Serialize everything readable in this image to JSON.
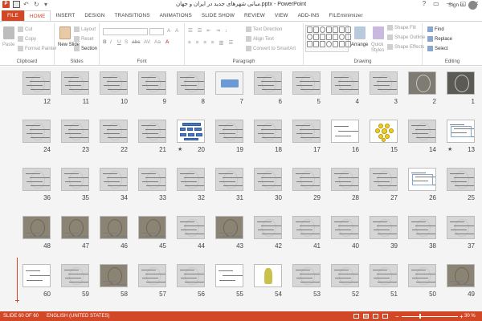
{
  "app": {
    "title": "مبانی شهرهای جدید در ایران و جهان.pptx - PowerPoint",
    "sign_in": "Sign in",
    "window_buttons": [
      "?",
      "▭",
      "—",
      "▢",
      "✕"
    ]
  },
  "tabs": [
    {
      "label": "FILE",
      "kind": "file"
    },
    {
      "label": "HOME",
      "kind": "active"
    },
    {
      "label": "INSERT",
      "kind": ""
    },
    {
      "label": "DESIGN",
      "kind": ""
    },
    {
      "label": "TRANSITIONS",
      "kind": ""
    },
    {
      "label": "ANIMATIONS",
      "kind": ""
    },
    {
      "label": "SLIDE SHOW",
      "kind": ""
    },
    {
      "label": "REVIEW",
      "kind": ""
    },
    {
      "label": "VIEW",
      "kind": ""
    },
    {
      "label": "ADD-INS",
      "kind": ""
    },
    {
      "label": "FILEminimizer",
      "kind": ""
    }
  ],
  "ribbon": {
    "clipboard": {
      "label": "Clipboard",
      "paste": "Paste",
      "cut": "Cut",
      "copy": "Copy",
      "format_painter": "Format Painter"
    },
    "slides": {
      "label": "Slides",
      "new_slide": "New Slide",
      "layout": "Layout",
      "reset": "Reset",
      "section": "Section"
    },
    "font": {
      "label": "Font",
      "format_buttons": [
        "B",
        "I",
        "U",
        "S",
        "abc",
        "AV",
        "Aa",
        "A"
      ]
    },
    "paragraph": {
      "label": "Paragraph",
      "text_direction": "Text Direction",
      "align_text": "Align Text",
      "convert_smartart": "Convert to SmartArt"
    },
    "drawing": {
      "label": "Drawing",
      "arrange": "Arrange",
      "quick_styles": "Quick Styles",
      "shape_fill": "Shape Fill",
      "shape_outline": "Shape Outline",
      "shape_effects": "Shape Effects"
    },
    "editing": {
      "label": "Editing",
      "find": "Find",
      "replace": "Replace",
      "select": "Select"
    }
  },
  "sorter": {
    "slides": [
      {
        "n": "1",
        "style": "darker",
        "star": false
      },
      {
        "n": "2",
        "style": "dark",
        "star": false
      },
      {
        "n": "3",
        "style": "",
        "star": false
      },
      {
        "n": "4",
        "style": "",
        "star": false
      },
      {
        "n": "5",
        "style": "",
        "star": false
      },
      {
        "n": "6",
        "style": "",
        "star": false
      },
      {
        "n": "7",
        "style": "blue",
        "star": false
      },
      {
        "n": "8",
        "style": "",
        "star": false
      },
      {
        "n": "9",
        "style": "",
        "star": false
      },
      {
        "n": "10",
        "style": "",
        "star": false
      },
      {
        "n": "11",
        "style": "",
        "star": false
      },
      {
        "n": "12",
        "style": "",
        "star": false
      },
      {
        "n": "13",
        "style": "chart",
        "star": true
      },
      {
        "n": "14",
        "style": "",
        "star": false
      },
      {
        "n": "15",
        "style": "yellow",
        "star": false
      },
      {
        "n": "16",
        "style": "white",
        "star": false
      },
      {
        "n": "17",
        "style": "",
        "star": false
      },
      {
        "n": "18",
        "style": "",
        "star": false
      },
      {
        "n": "19",
        "style": "",
        "star": false
      },
      {
        "n": "20",
        "style": "bluediag",
        "star": true
      },
      {
        "n": "21",
        "style": "",
        "star": false
      },
      {
        "n": "22",
        "style": "",
        "star": false
      },
      {
        "n": "23",
        "style": "",
        "star": false
      },
      {
        "n": "24",
        "style": "",
        "star": false
      },
      {
        "n": "25",
        "style": "",
        "star": false
      },
      {
        "n": "26",
        "style": "chart",
        "star": false
      },
      {
        "n": "27",
        "style": "",
        "star": false
      },
      {
        "n": "28",
        "style": "",
        "star": false
      },
      {
        "n": "29",
        "style": "",
        "star": false
      },
      {
        "n": "30",
        "style": "",
        "star": false
      },
      {
        "n": "31",
        "style": "",
        "star": false
      },
      {
        "n": "32",
        "style": "",
        "star": false
      },
      {
        "n": "33",
        "style": "",
        "star": false
      },
      {
        "n": "34",
        "style": "",
        "star": false
      },
      {
        "n": "35",
        "style": "",
        "star": false
      },
      {
        "n": "36",
        "style": "",
        "star": false
      },
      {
        "n": "37",
        "style": "",
        "star": false
      },
      {
        "n": "38",
        "style": "",
        "star": false
      },
      {
        "n": "39",
        "style": "",
        "star": false
      },
      {
        "n": "40",
        "style": "",
        "star": false
      },
      {
        "n": "41",
        "style": "",
        "star": false
      },
      {
        "n": "42",
        "style": "",
        "star": false
      },
      {
        "n": "43",
        "style": "photo",
        "star": false
      },
      {
        "n": "44",
        "style": "",
        "star": false
      },
      {
        "n": "45",
        "style": "photo",
        "star": false
      },
      {
        "n": "46",
        "style": "photo",
        "star": false
      },
      {
        "n": "47",
        "style": "photo",
        "star": false
      },
      {
        "n": "48",
        "style": "photo",
        "star": false
      },
      {
        "n": "49",
        "style": "photo",
        "star": false
      },
      {
        "n": "50",
        "style": "",
        "star": false
      },
      {
        "n": "51",
        "style": "",
        "star": false
      },
      {
        "n": "52",
        "style": "",
        "star": false
      },
      {
        "n": "53",
        "style": "",
        "star": false
      },
      {
        "n": "54",
        "style": "plant",
        "star": false
      },
      {
        "n": "55",
        "style": "white",
        "star": false
      },
      {
        "n": "56",
        "style": "",
        "star": false
      },
      {
        "n": "57",
        "style": "",
        "star": false
      },
      {
        "n": "58",
        "style": "photo",
        "star": false
      },
      {
        "n": "59",
        "style": "",
        "star": false
      },
      {
        "n": "60",
        "style": "white",
        "star": false
      }
    ]
  },
  "status": {
    "slide_pos": "SLIDE 60 OF 60",
    "language": "ENGLISH (UNITED STATES)",
    "zoom": "30 %",
    "zoom_minus": "−",
    "zoom_plus": "+"
  },
  "colors": {
    "accent": "#d24726"
  }
}
